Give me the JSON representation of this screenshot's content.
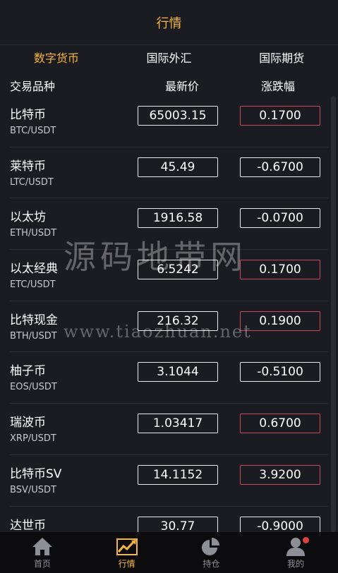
{
  "header": {
    "title": "行情"
  },
  "tabs": [
    {
      "label": "数字货币",
      "active": true
    },
    {
      "label": "国际外汇",
      "active": false
    },
    {
      "label": "国际期货",
      "active": false
    }
  ],
  "columns": {
    "symbol": "交易品种",
    "price": "最新价",
    "change": "涨跌幅"
  },
  "rows": [
    {
      "name": "比特币",
      "pair": "BTC/USDT",
      "price": "65003.15",
      "change": "0.1700",
      "up": true
    },
    {
      "name": "莱特币",
      "pair": "LTC/USDT",
      "price": "45.49",
      "change": "-0.6700",
      "up": false
    },
    {
      "name": "以太坊",
      "pair": "ETH/USDT",
      "price": "1916.58",
      "change": "-0.0700",
      "up": false
    },
    {
      "name": "以太经典",
      "pair": "ETC/USDT",
      "price": "6.5242",
      "change": "0.1700",
      "up": true
    },
    {
      "name": "比特现金",
      "pair": "BTH/USDT",
      "price": "216.32",
      "change": "0.1900",
      "up": true
    },
    {
      "name": "柚子币",
      "pair": "EOS/USDT",
      "price": "3.1044",
      "change": "-0.5100",
      "up": false
    },
    {
      "name": "瑞波币",
      "pair": "XRP/USDT",
      "price": "1.03417",
      "change": "0.6700",
      "up": true
    },
    {
      "name": "比特币SV",
      "pair": "BSV/USDT",
      "price": "14.1152",
      "change": "3.9200",
      "up": true
    },
    {
      "name": "达世币",
      "pair": "",
      "price": "30.77",
      "change": "-0.9000",
      "up": false
    }
  ],
  "watermark": {
    "text": "源码地带网",
    "url": "www.tiaozhuan.net"
  },
  "tabbar": [
    {
      "label": "首页",
      "icon": "home-icon",
      "active": false
    },
    {
      "label": "行情",
      "icon": "chart-icon",
      "active": true
    },
    {
      "label": "持仓",
      "icon": "pie-icon",
      "active": false
    },
    {
      "label": "我的",
      "icon": "user-icon",
      "active": false,
      "badge": true
    }
  ],
  "colors": {
    "accent": "#f4b63f",
    "up_border": "#c54a5e",
    "background": "#1b1b22",
    "tabbar": "#0c0c0f",
    "badge": "#e0433d"
  }
}
